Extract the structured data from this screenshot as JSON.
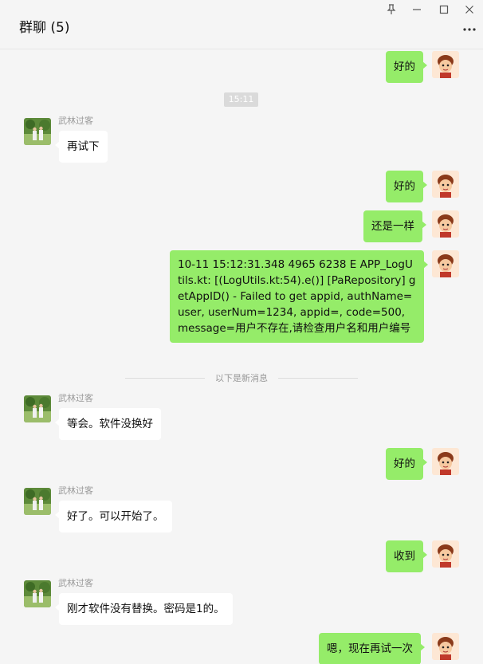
{
  "header": {
    "title": "群聊 (5)",
    "icons": [
      "pin-icon",
      "minimize-icon",
      "maximize-icon",
      "close-icon",
      "more-icon"
    ]
  },
  "chat": {
    "time_label": "15:11",
    "new_messages_label": "以下是新消息",
    "sender_other": "武林过客",
    "messages": [
      {
        "from": "me",
        "text": "好的"
      },
      {
        "from": "other",
        "text": "再试下"
      },
      {
        "from": "me",
        "text": "好的"
      },
      {
        "from": "me",
        "text": "还是一样"
      },
      {
        "from": "me",
        "text": "10-11 15:12:31.348  4965  6238 E APP_LogUtils.kt: [(LogUtils.kt:54).e()] [PaRepository] getAppID() - Failed to get appid, authName=user, userNum=1234, appid=, code=500, message=用户不存在,请检查用户名和用户编号"
      },
      {
        "from": "other",
        "text": "等会。软件没换好"
      },
      {
        "from": "me",
        "text": "好的"
      },
      {
        "from": "other",
        "text": "好了。可以开始了。"
      },
      {
        "from": "me",
        "text": "收到"
      },
      {
        "from": "other",
        "text": "刚才软件没有替换。密码是1的。"
      },
      {
        "from": "me",
        "text": "嗯，现在再试一次"
      }
    ]
  },
  "colors": {
    "me_bubble": "#95ec69",
    "other_bubble": "#ffffff",
    "background": "#f5f5f5"
  }
}
